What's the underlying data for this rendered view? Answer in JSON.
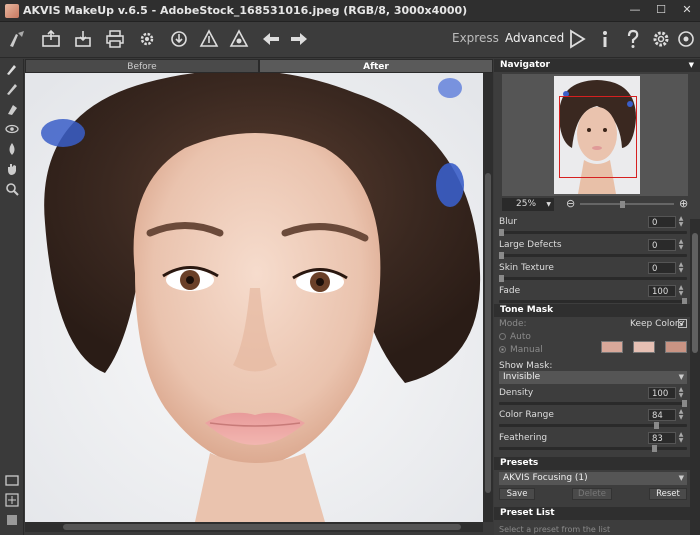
{
  "window": {
    "title": "AKVIS MakeUp v.6.5 - AdobeStock_168531016.jpeg (RGB/8, 3000x4000)"
  },
  "toolbar": {
    "express_label": "Express",
    "advanced_label": "Advanced"
  },
  "view_tabs": {
    "before_label": "Before",
    "after_label": "After"
  },
  "navigator": {
    "title": "Navigator",
    "zoom": "25%"
  },
  "sliders": [
    {
      "label": "Blur",
      "value": "0"
    },
    {
      "label": "Large Defects",
      "value": "0"
    },
    {
      "label": "Skin Texture",
      "value": "0"
    },
    {
      "label": "Fade",
      "value": "100"
    }
  ],
  "tone_mask": {
    "title": "Tone Mask",
    "mode_label": "Mode:",
    "keep_colors_label": "Keep Colors",
    "keep_colors_checked": true,
    "auto_label": "Auto",
    "manual_label": "Manual",
    "swatch_colors": [
      "#d8a89a",
      "#e6c0b4",
      "#c99484"
    ],
    "show_mask_label": "Show Mask:",
    "show_mask_value": "Invisible",
    "density_label": "Density",
    "density_value": "100",
    "color_range_label": "Color Range",
    "color_range_value": "84",
    "feathering_label": "Feathering",
    "feathering_value": "83"
  },
  "presets": {
    "title": "Presets",
    "selected": "AKVIS Focusing (1)",
    "save_label": "Save",
    "delete_label": "Delete",
    "reset_label": "Reset"
  },
  "preset_list": {
    "title": "Preset List",
    "hint": "Select a preset from the list"
  }
}
